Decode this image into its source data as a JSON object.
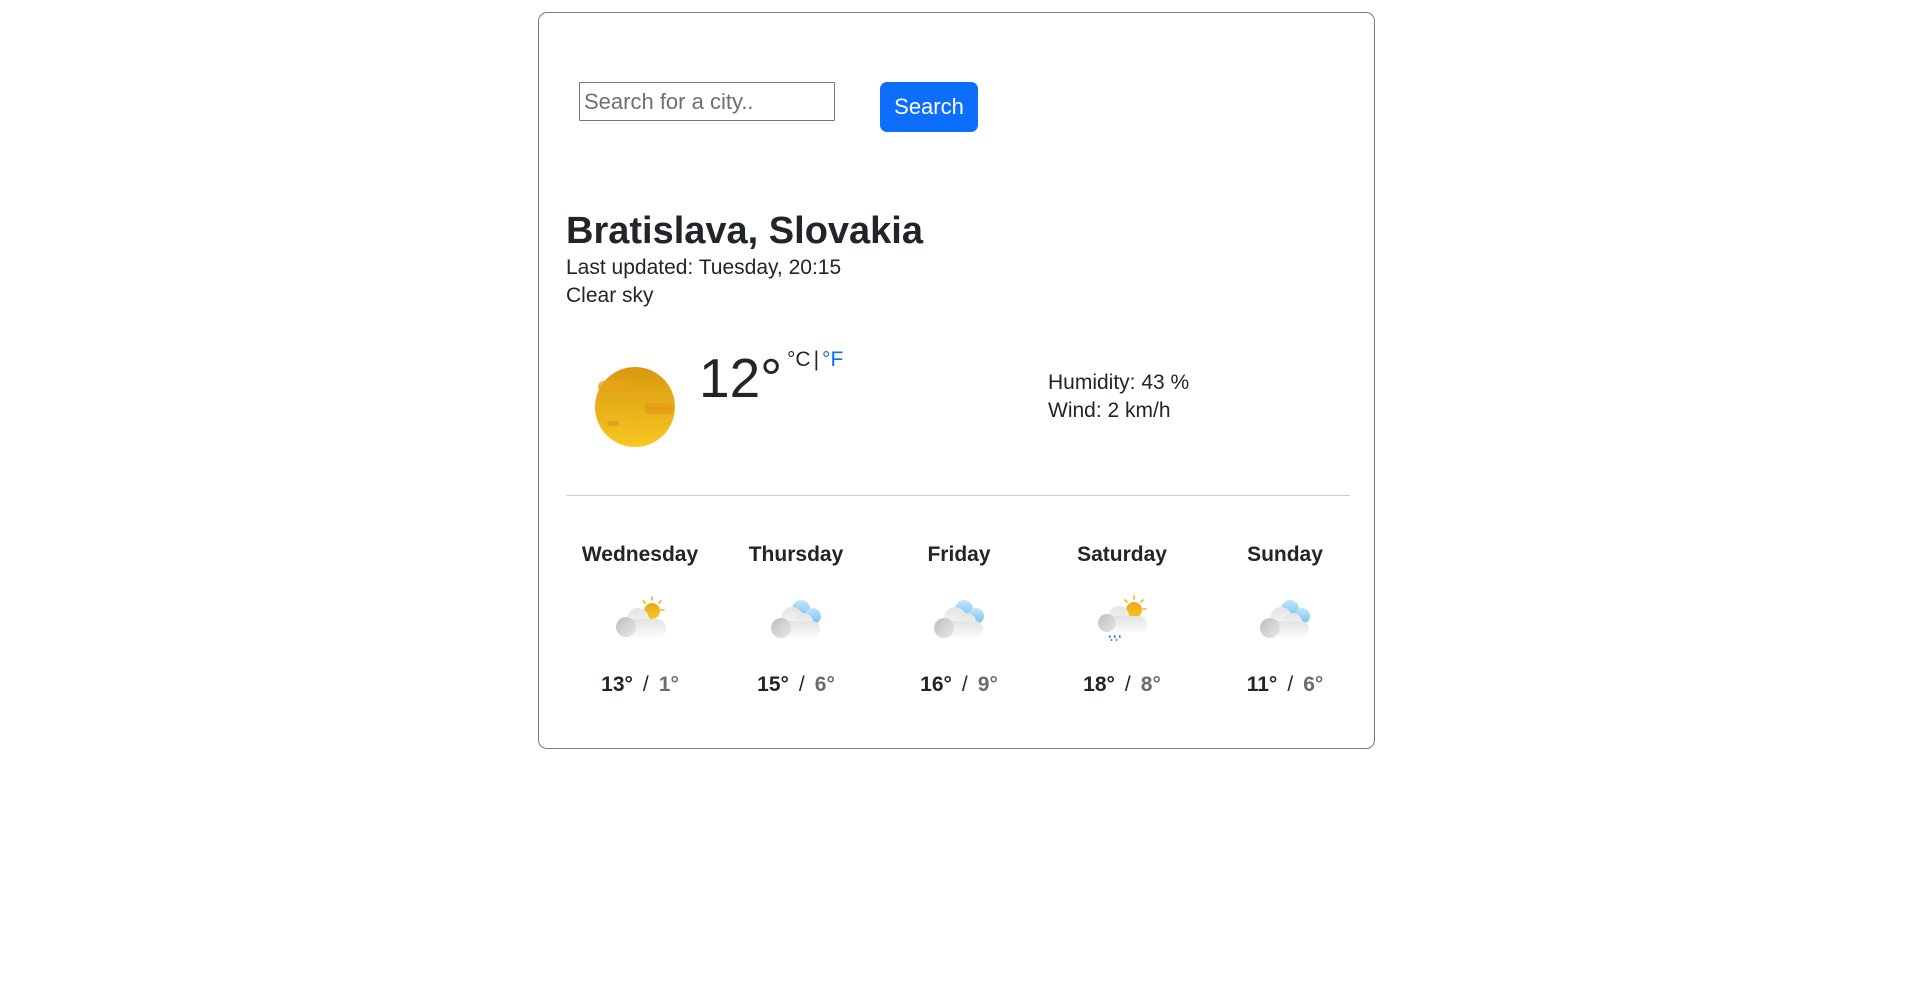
{
  "search": {
    "placeholder": "Search for a city..",
    "value": "",
    "button_label": "Search"
  },
  "current": {
    "city": "Bratislava, Slovakia",
    "last_updated": "Last updated: Tuesday, 20:15",
    "description": "Clear sky",
    "icon": "clear-sky-sun-icon",
    "temperature": "12°",
    "unit_celsius": "°C",
    "unit_separator": "|",
    "unit_fahrenheit": "°F",
    "humidity": "Humidity: 43 %",
    "wind": "Wind:  2 km/h"
  },
  "forecast": [
    {
      "day": "Wednesday",
      "icon": "partly-cloudy-sun-icon",
      "high": "13°",
      "low": "1°"
    },
    {
      "day": "Thursday",
      "icon": "cloudy-icon",
      "high": "15°",
      "low": "6°"
    },
    {
      "day": "Friday",
      "icon": "cloudy-icon",
      "high": "16°",
      "low": "9°"
    },
    {
      "day": "Saturday",
      "icon": "sun-cloud-rain-icon",
      "high": "18°",
      "low": "8°"
    },
    {
      "day": "Sunday",
      "icon": "cloudy-icon",
      "high": "11°",
      "low": "6°"
    }
  ],
  "forecast_separator": "/",
  "colors": {
    "accent": "#0d6efd",
    "text": "#212529",
    "muted": "#6c6c6c",
    "sun": "#f0b21a",
    "cloud_blue": "#8ecdf5",
    "rain": "#2a8fd6"
  }
}
